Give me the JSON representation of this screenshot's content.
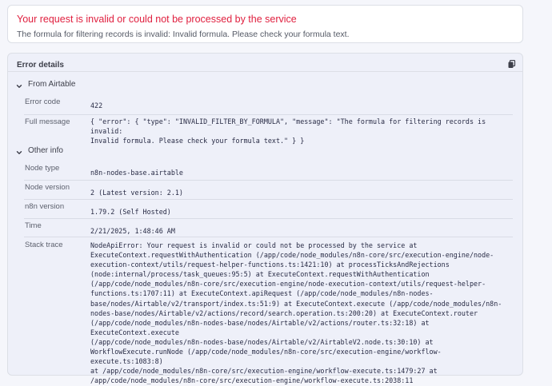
{
  "banner": {
    "title": "Your request is invalid or could not be processed by the service",
    "description": "The formula for filtering records is invalid: Invalid formula. Please check your formula text."
  },
  "details": {
    "title": "Error details",
    "copy_icon": "copy-icon",
    "sections": {
      "from_airtable": {
        "label": "From Airtable",
        "error_code_label": "Error code",
        "error_code_value": "422",
        "full_message_label": "Full message",
        "full_message_value": "{ \"error\": { \"type\": \"INVALID_FILTER_BY_FORMULA\", \"message\": \"The formula for filtering records is invalid:\nInvalid formula. Please check your formula text.\" } }"
      },
      "other_info": {
        "label": "Other info",
        "node_type_label": "Node type",
        "node_type_value": "n8n-nodes-base.airtable",
        "node_version_label": "Node version",
        "node_version_value": "2 (Latest version: 2.1)",
        "n8n_version_label": "n8n version",
        "n8n_version_value": "1.79.2 (Self Hosted)",
        "time_label": "Time",
        "time_value": "2/21/2025, 1:48:46 AM",
        "stack_trace_label": "Stack trace",
        "stack_trace_value": "NodeApiError: Your request is invalid or could not be processed by the service at\nExecuteContext.requestWithAuthentication (/app/code/node_modules/n8n-core/src/execution-engine/node-\nexecution-context/utils/request-helper-functions.ts:1421:10) at processTicksAndRejections\n(node:internal/process/task_queues:95:5) at ExecuteContext.requestWithAuthentication\n(/app/code/node_modules/n8n-core/src/execution-engine/node-execution-context/utils/request-helper-\nfunctions.ts:1707:11) at ExecuteContext.apiRequest (/app/code/node_modules/n8n-nodes-\nbase/nodes/Airtable/v2/transport/index.ts:51:9) at ExecuteContext.execute (/app/code/node_modules/n8n-\nnodes-base/nodes/Airtable/v2/actions/record/search.operation.ts:200:20) at ExecuteContext.router\n(/app/code/node_modules/n8n-nodes-base/nodes/Airtable/v2/actions/router.ts:32:18) at ExecuteContext.execute\n(/app/code/node_modules/n8n-nodes-base/nodes/Airtable/v2/AirtableV2.node.ts:30:10) at\nWorkflowExecute.runNode (/app/code/node_modules/n8n-core/src/execution-engine/workflow-execute.ts:1083:8)\nat /app/code/node_modules/n8n-core/src/execution-engine/workflow-execute.ts:1479:27 at\n/app/code/node_modules/n8n-core/src/execution-engine/workflow-execute.ts:2038:11"
      }
    }
  }
}
